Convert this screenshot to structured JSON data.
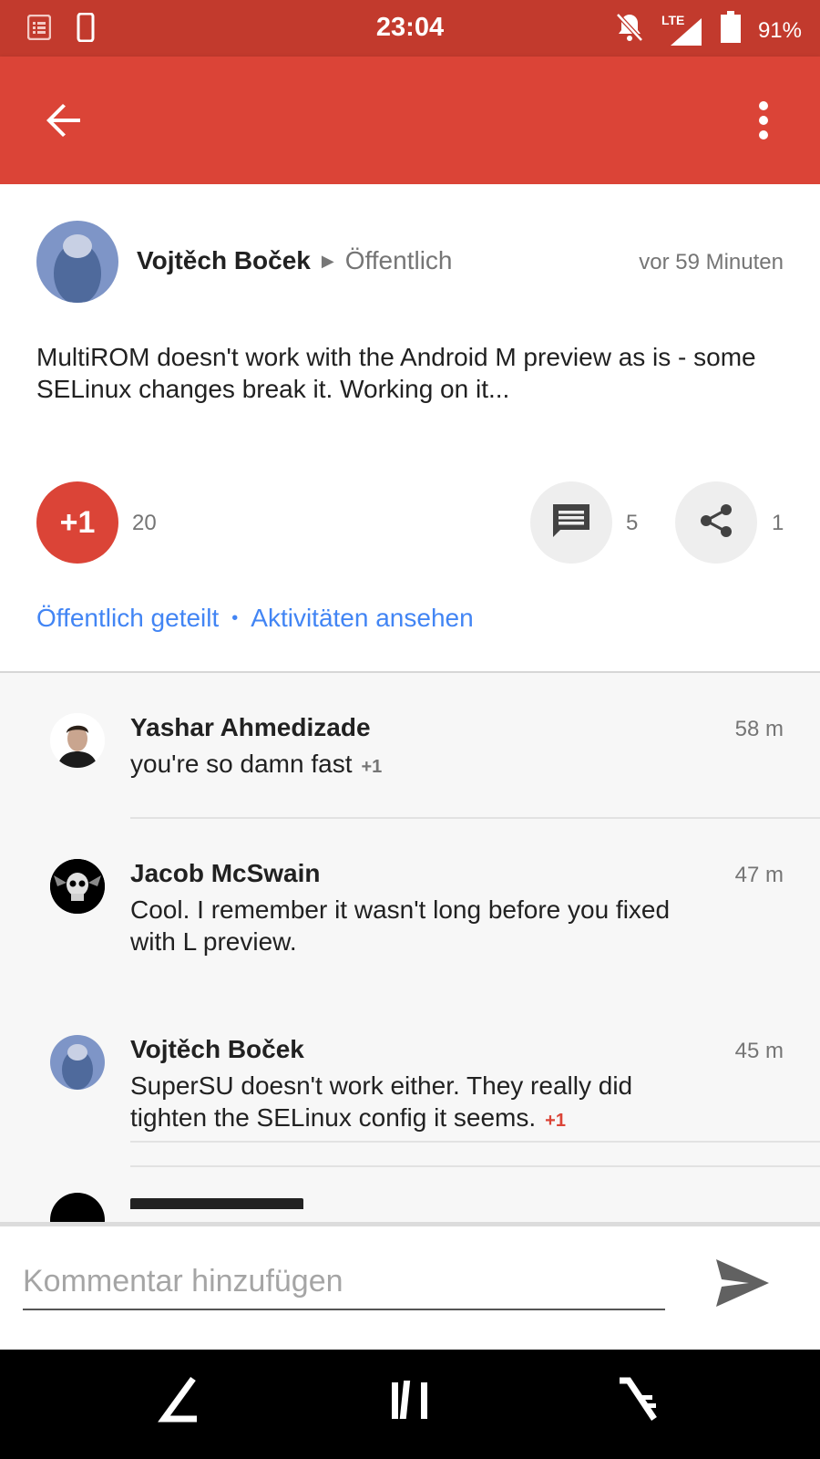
{
  "status_bar": {
    "time": "23:04",
    "battery_percent": "91%",
    "network": "LTE",
    "icons": [
      "notification-list-icon",
      "phone-icon",
      "bell-off-icon",
      "signal-icon",
      "battery-icon"
    ]
  },
  "colors": {
    "status_bar": "#c23a2d",
    "app_bar": "#db4437",
    "plus_one": "#db4437",
    "link": "#4285f4"
  },
  "post": {
    "author": "Vojtěch Boček",
    "audience": "Öffentlich",
    "time": "vor 59 Minuten",
    "text": "MultiROM doesn't work with the Android M preview as is - some SELinux changes break it. Working on it...",
    "plus_label": "+1",
    "plus_count": "20",
    "comment_count": "5",
    "share_count": "1",
    "shared_link": "Öffentlich geteilt",
    "separator": "•",
    "activity_link": "Aktivitäten ansehen"
  },
  "comments": [
    {
      "name": "Yashar Ahmedizade",
      "time": "58 m",
      "text": "you're so damn fast",
      "plus": "+1"
    },
    {
      "name": "Jacob McSwain",
      "time": "47 m",
      "text": "Cool. I remember it wasn't long before you fixed with L preview.",
      "plus": ""
    },
    {
      "name": "Vojtěch Boček",
      "time": "45 m",
      "text": "SuperSU doesn't work either. They really did tighten the SELinux config it seems.",
      "plus": "+1"
    }
  ],
  "compose": {
    "placeholder": "Kommentar hinzufügen"
  }
}
